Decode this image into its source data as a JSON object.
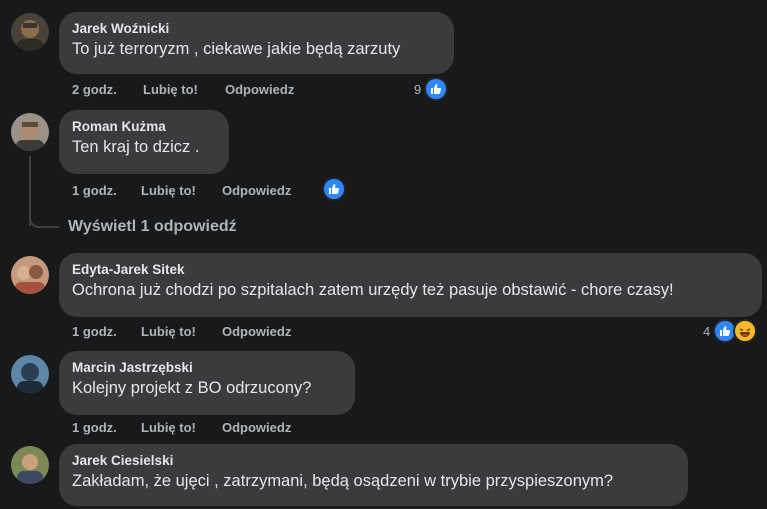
{
  "comments": [
    {
      "author": "Jarek Woźnicki",
      "text": "To już terroryzm , ciekawe jakie będą zarzuty",
      "time": "2 godz.",
      "like": "Lubię to!",
      "reply": "Odpowiedz",
      "reaction_count": "9",
      "avatar_color": "#6b5a3e"
    },
    {
      "author": "Roman Kużma",
      "text": "Ten kraj to dzicz .",
      "time": "1 godz.",
      "like": "Lubię to!",
      "reply": "Odpowiedz",
      "reaction_count": "",
      "avatar_color": "#7a6a5c",
      "view_replies": "Wyświetl 1 odpowiedź"
    },
    {
      "author": "Edyta-Jarek Sitek",
      "text": "Ochrona już chodzi po szpitalach zatem urzędy też pasuje obstawić - chore czasy!",
      "time": "1 godz.",
      "like": "Lubię to!",
      "reply": "Odpowiedz",
      "reaction_count": "4",
      "avatar_color": "#a0705a"
    },
    {
      "author": "Marcin Jastrzębski",
      "text": "Kolejny projekt z BO odrzucony?",
      "time": "1 godz.",
      "like": "Lubię to!",
      "reply": "Odpowiedz",
      "reaction_count": "",
      "avatar_color": "#3b5f7a"
    },
    {
      "author": "Jarek Ciesielski",
      "text": "Zakładam, że ujęci , zatrzymani, będą osądzeni w trybie przyspieszonym?",
      "time": "",
      "like": "",
      "reply": "",
      "reaction_count": "",
      "avatar_color": "#6a6a3a"
    }
  ],
  "theme": {
    "bubble": "#3a3b3c",
    "background": "#18191a",
    "like_blue": "#2d88ff",
    "haha_yellow": "#f7b928"
  }
}
